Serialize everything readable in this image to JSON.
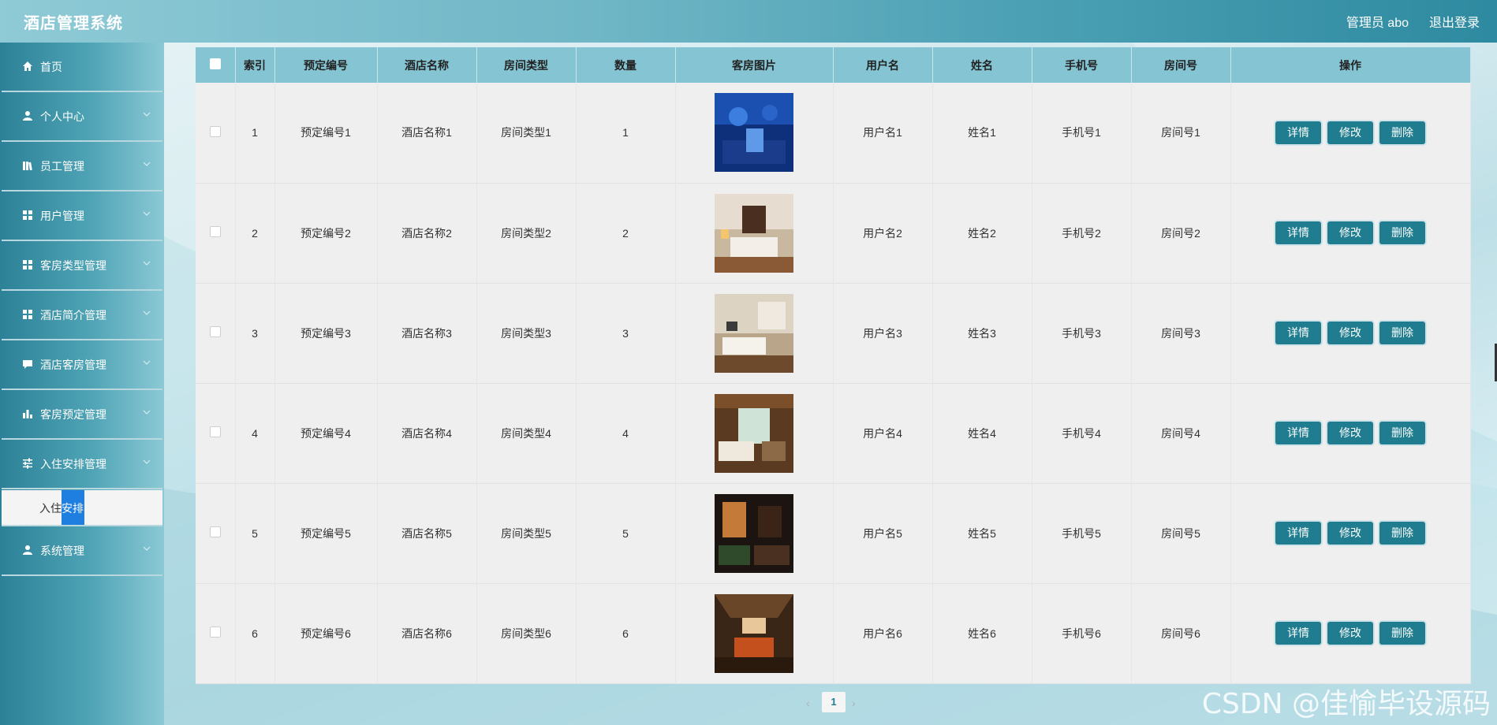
{
  "header": {
    "app_title": "酒店管理系统",
    "admin_label": "管理员 abo",
    "logout_label": "退出登录"
  },
  "sidebar": {
    "items": [
      {
        "label": "首页",
        "icon": "home-icon"
      },
      {
        "label": "个人中心",
        "icon": "user-icon"
      },
      {
        "label": "员工管理",
        "icon": "library-icon"
      },
      {
        "label": "用户管理",
        "icon": "grid-icon"
      },
      {
        "label": "客房类型管理",
        "icon": "grid-icon"
      },
      {
        "label": "酒店简介管理",
        "icon": "grid-icon"
      },
      {
        "label": "酒店客房管理",
        "icon": "comment-icon"
      },
      {
        "label": "客房预定管理",
        "icon": "bar-chart-icon"
      },
      {
        "label": "入住安排管理",
        "icon": "sliders-icon"
      },
      {
        "label": "系统管理",
        "icon": "user-icon"
      }
    ],
    "submenu": {
      "label_prefix": "入住",
      "label_highlight": "安排"
    }
  },
  "table": {
    "headers": [
      "索引",
      "预定编号",
      "酒店名称",
      "房间类型",
      "数量",
      "客房图片",
      "用户名",
      "姓名",
      "手机号",
      "房间号",
      "操作"
    ],
    "rows": [
      {
        "index": "1",
        "booking_no": "预定编号1",
        "hotel": "酒店名称1",
        "room_type": "房间类型1",
        "qty": "1",
        "username": "用户名1",
        "name": "姓名1",
        "phone": "手机号1",
        "room_no": "房间号1"
      },
      {
        "index": "2",
        "booking_no": "预定编号2",
        "hotel": "酒店名称2",
        "room_type": "房间类型2",
        "qty": "2",
        "username": "用户名2",
        "name": "姓名2",
        "phone": "手机号2",
        "room_no": "房间号2"
      },
      {
        "index": "3",
        "booking_no": "预定编号3",
        "hotel": "酒店名称3",
        "room_type": "房间类型3",
        "qty": "3",
        "username": "用户名3",
        "name": "姓名3",
        "phone": "手机号3",
        "room_no": "房间号3"
      },
      {
        "index": "4",
        "booking_no": "预定编号4",
        "hotel": "酒店名称4",
        "room_type": "房间类型4",
        "qty": "4",
        "username": "用户名4",
        "name": "姓名4",
        "phone": "手机号4",
        "room_no": "房间号4"
      },
      {
        "index": "5",
        "booking_no": "预定编号5",
        "hotel": "酒店名称5",
        "room_type": "房间类型5",
        "qty": "5",
        "username": "用户名5",
        "name": "姓名5",
        "phone": "手机号5",
        "room_no": "房间号5"
      },
      {
        "index": "6",
        "booking_no": "预定编号6",
        "hotel": "酒店名称6",
        "room_type": "房间类型6",
        "qty": "6",
        "username": "用户名6",
        "name": "姓名6",
        "phone": "手机号6",
        "room_no": "房间号6"
      }
    ],
    "actions": {
      "detail": "详情",
      "edit": "修改",
      "delete": "删除"
    }
  },
  "pagination": {
    "prev": "‹",
    "current": "1",
    "next": "›"
  },
  "watermark": "CSDN @佳愉毕设源码",
  "colors": {
    "primary": "#1f7d8f",
    "header_bg": "#85c5d3",
    "submenu_highlight": "#1f7fe0"
  }
}
